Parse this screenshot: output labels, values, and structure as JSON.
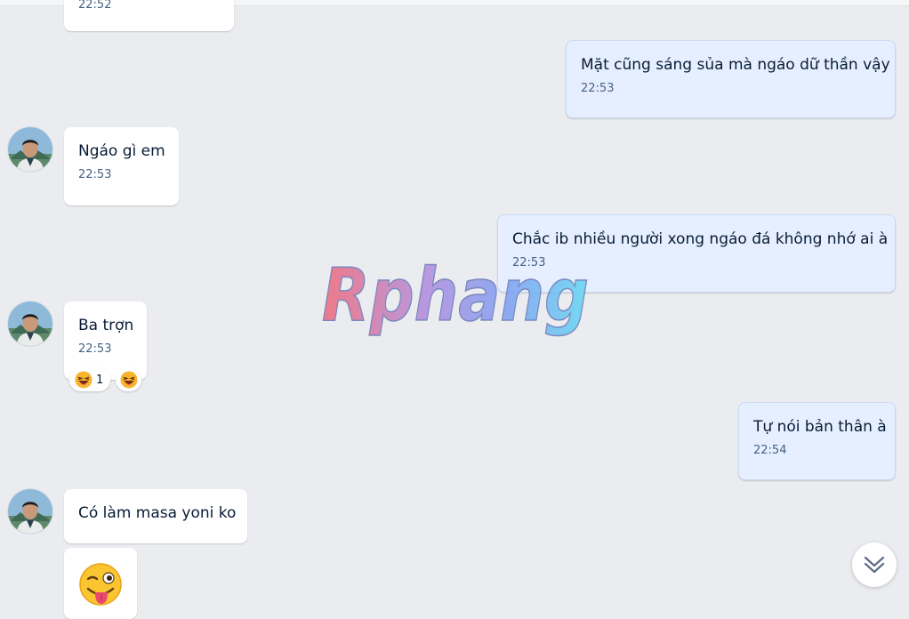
{
  "conversation": {
    "messages": [
      {
        "time": "22:52"
      },
      {
        "text": "Mặt cũng sáng sủa mà ngáo dữ thần vậy",
        "time": "22:53"
      },
      {
        "text": "Ngáo gì em",
        "time": "22:53"
      },
      {
        "text": "Chắc ib nhiều người xong ngáo đá không nhớ ai à",
        "time": "22:53"
      },
      {
        "text": "Ba trợn",
        "time": "22:53",
        "reaction_icon": "laughing-emoji",
        "reaction_count": "1"
      },
      {
        "text": "Tự nói bản thân à",
        "time": "22:54"
      },
      {
        "text": "Có làm masa yoni ko",
        "sticker": "winking-tongue-emoji"
      }
    ]
  },
  "watermark": {
    "text": "Rphang"
  },
  "colors": {
    "background": "#ebecf0",
    "incoming_bubble": "#ffffff",
    "outgoing_bubble": "#e5efff",
    "text": "#081c36",
    "time": "#476285"
  },
  "icons": {
    "scroll_down": "double-chevron-down-icon",
    "avatar": "user-avatar"
  }
}
